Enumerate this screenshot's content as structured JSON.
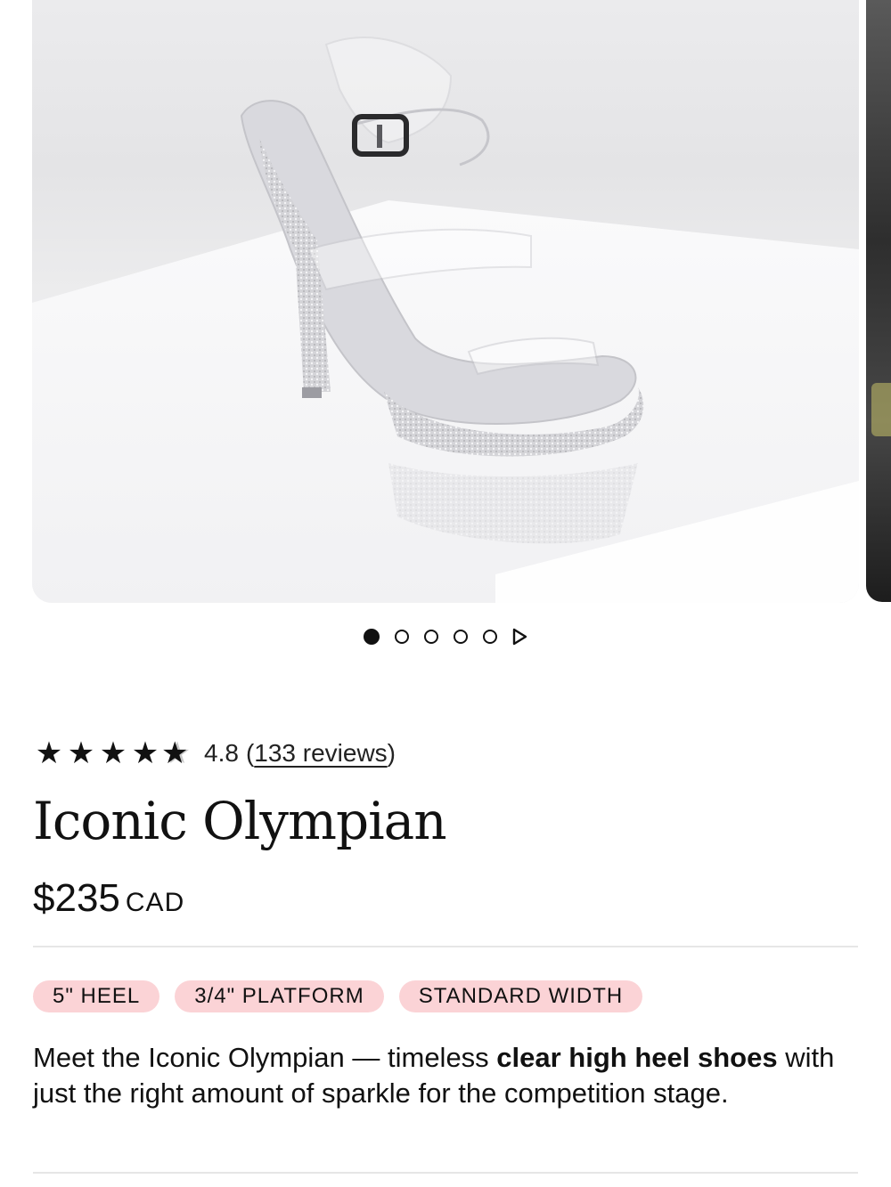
{
  "product": {
    "rating": {
      "stars_value": 4.8,
      "stars_max": 5,
      "value_text": "4.8",
      "open_paren": "(",
      "reviews_label": "133 reviews",
      "close_paren": ")"
    },
    "title": "Iconic Olympian",
    "price": {
      "amount": "$235",
      "currency": "CAD"
    },
    "tags": [
      "5\" HEEL",
      "3/4\" PLATFORM",
      "STANDARD WIDTH"
    ],
    "description": {
      "part1": "Meet the Iconic Olympian — timeless ",
      "bold": "clear high heel shoes",
      "part2": " with just the right amount of sparkle for the competition stage."
    }
  },
  "gallery": {
    "slide_count": 5,
    "active_index": 0,
    "icons": {
      "play": "play-icon",
      "star": "star-icon"
    }
  },
  "colors": {
    "tag_background": "#fbd3d6",
    "text": "#111111",
    "divider": "#e6e6e6"
  }
}
